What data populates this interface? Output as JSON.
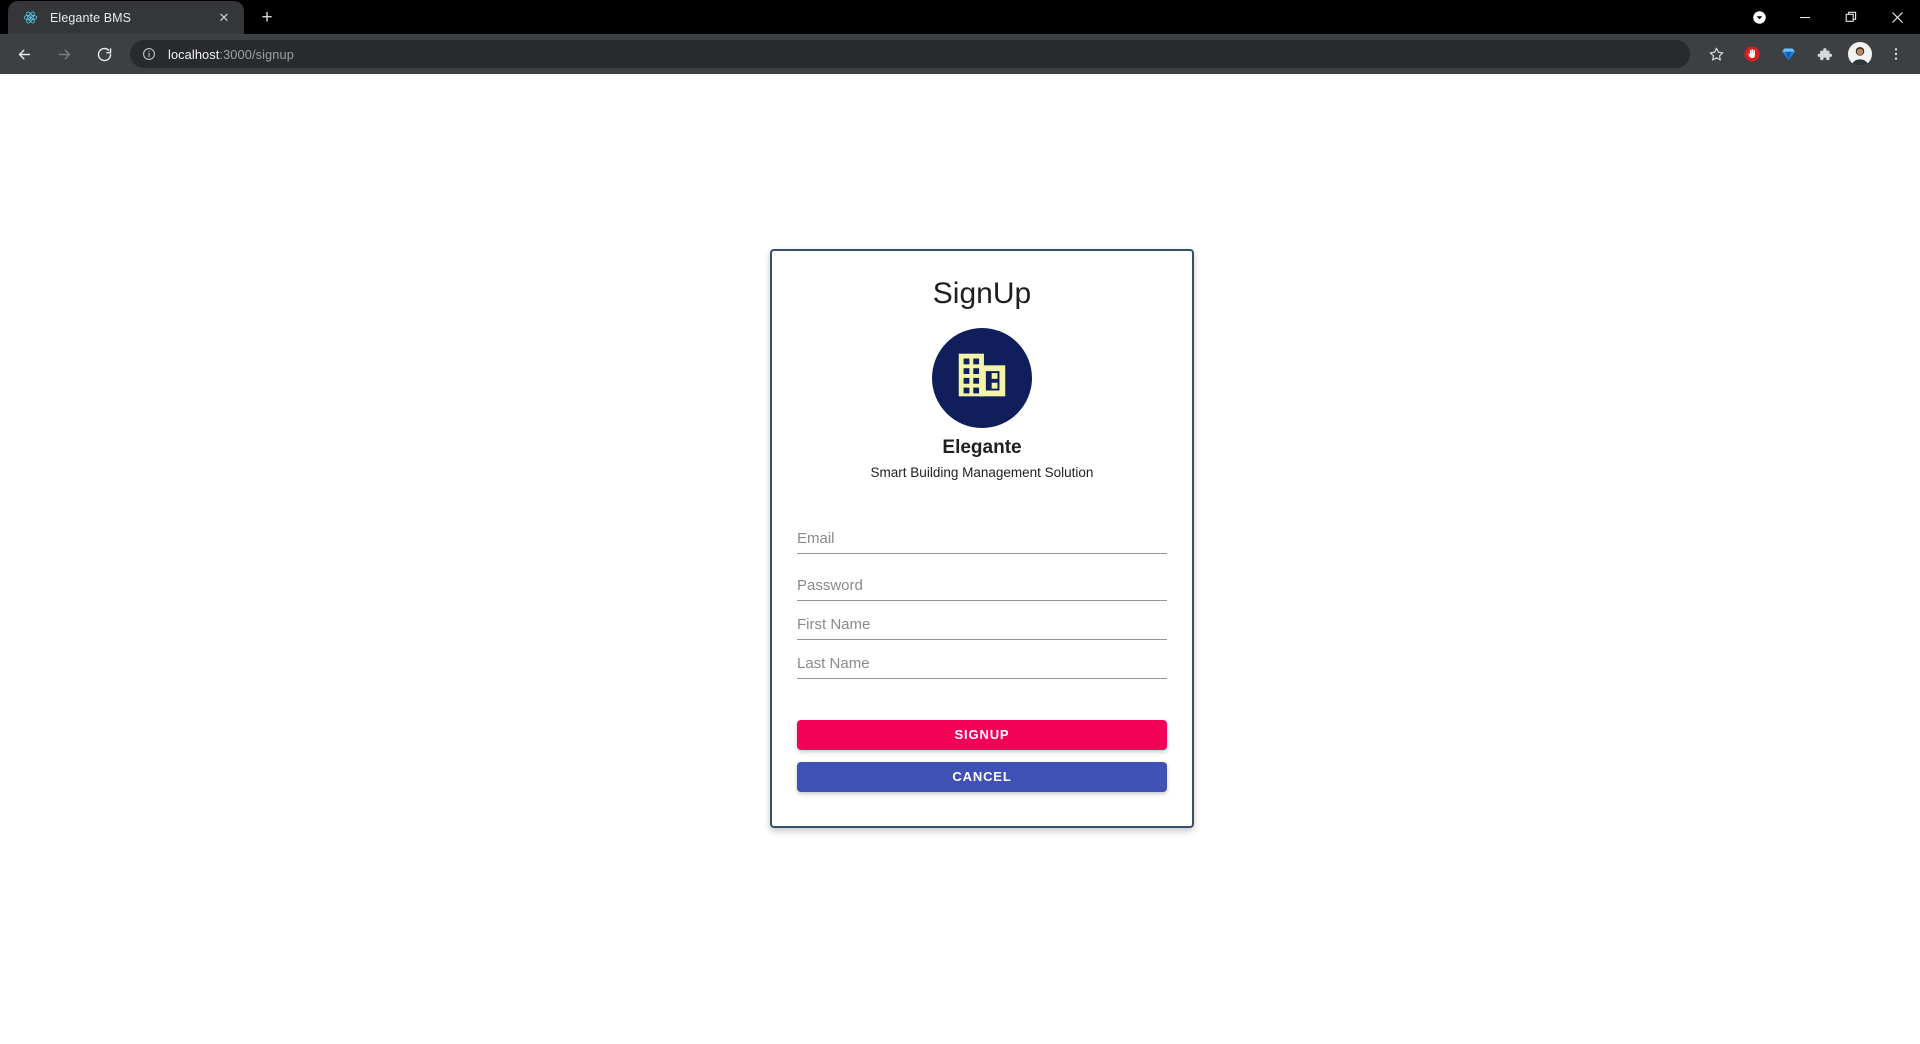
{
  "browser": {
    "tab": {
      "title": "Elegante BMS",
      "favicon_icon": "react-logo-icon",
      "close_glyph": "✕"
    },
    "new_tab_glyph": "+",
    "window_controls": {
      "download_icon": "download-indicator-icon",
      "minimize_glyph": "–",
      "maximize_glyph": "❐",
      "close_glyph": "✕"
    },
    "toolbar": {
      "back_icon": "back-arrow-icon",
      "forward_icon": "forward-arrow-icon",
      "reload_icon": "reload-icon",
      "site_info_icon": "info-circle-icon",
      "url_host": "localhost",
      "url_path": ":3000/signup",
      "url_full": "localhost:3000/signup",
      "bookmark_icon": "bookmark-star-icon",
      "adblock_icon": "adblock-stop-hand-icon",
      "gem_icon": "blue-gem-icon",
      "extensions_icon": "puzzle-piece-icon",
      "profile_icon": "user-avatar-icon",
      "menu_icon": "three-dot-menu-icon"
    }
  },
  "page": {
    "card": {
      "title": "SignUp",
      "logo": {
        "icon_name": "building-icon",
        "circle_color": "#101f5c",
        "glyph_color": "#f2f5a8"
      },
      "brand_name": "Elegante",
      "brand_tagline": "Smart Building Management Solution",
      "fields": [
        {
          "name": "email",
          "placeholder": "Email",
          "value": "",
          "type": "text"
        },
        {
          "name": "password",
          "placeholder": "Password",
          "value": "",
          "type": "password"
        },
        {
          "name": "first-name",
          "placeholder": "First Name",
          "value": "",
          "type": "text"
        },
        {
          "name": "last-name",
          "placeholder": "Last Name",
          "value": "",
          "type": "text"
        }
      ],
      "buttons": {
        "submit_label": "SIGNUP",
        "submit_color": "#f50057",
        "cancel_label": "CANCEL",
        "cancel_color": "#3f51b5"
      },
      "border_color": "#34506d"
    }
  }
}
